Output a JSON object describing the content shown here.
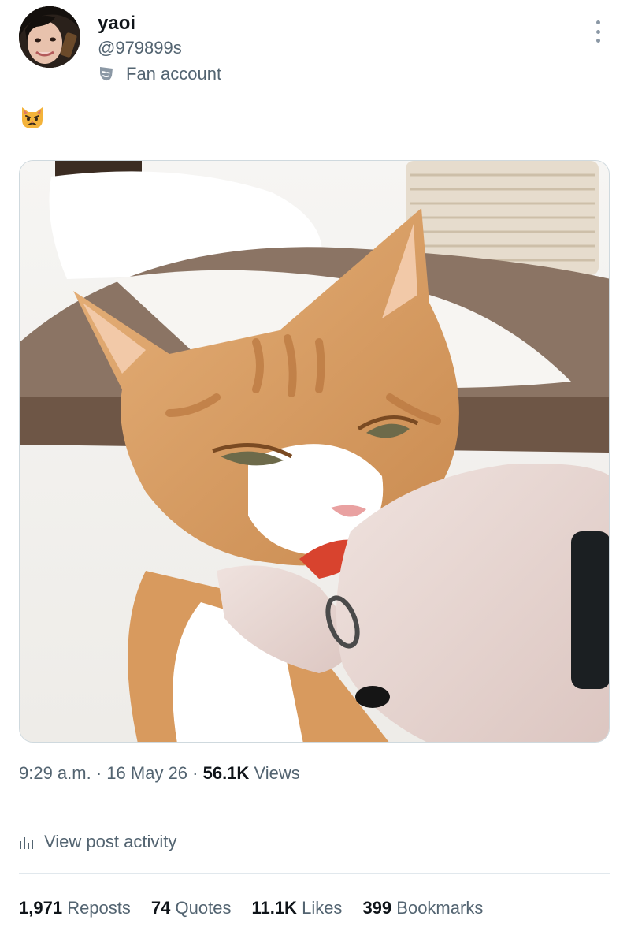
{
  "author": {
    "name": "yaoi",
    "handle": "@979899s",
    "badge_label": "Fan account",
    "badge_icon": "theater-masks-icon"
  },
  "post": {
    "emoji": "pouting-cat-emoji",
    "media_alt": "orange tabby cat eating a treat from a hand",
    "time": "9:29 a.m.",
    "separator": "·",
    "date": "16 May 26",
    "views_count": "56.1K",
    "views_label": "Views"
  },
  "activity": {
    "label": "View post activity",
    "icon": "bar-chart-icon"
  },
  "stats": [
    {
      "count": "1,971",
      "label": "Reposts"
    },
    {
      "count": "74",
      "label": "Quotes"
    },
    {
      "count": "11.1K",
      "label": "Likes"
    },
    {
      "count": "399",
      "label": "Bookmarks"
    }
  ],
  "colors": {
    "text": "#0f1419",
    "secondary": "#536471",
    "divider": "#e1e8ed"
  }
}
